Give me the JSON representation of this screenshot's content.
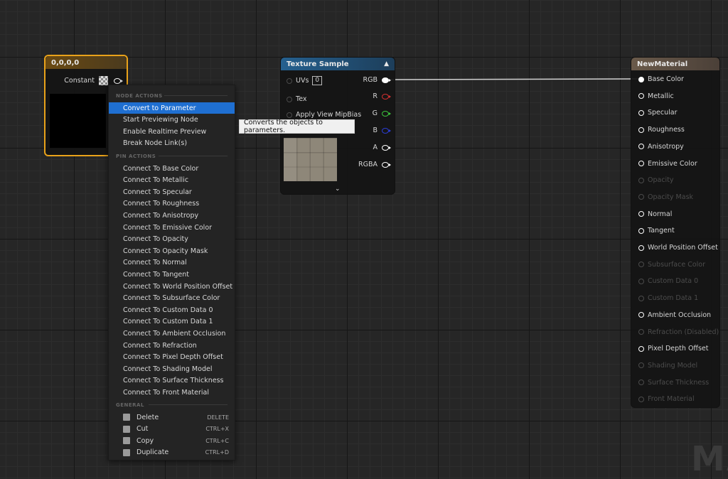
{
  "constant_node": {
    "title": "0,0,0,0",
    "pin_label": "Constant"
  },
  "texture_node": {
    "title": "Texture Sample",
    "inputs": [
      {
        "label": "UVs",
        "value": "0"
      },
      {
        "label": "Tex"
      },
      {
        "label": "Apply View MipBias"
      }
    ],
    "outputs": [
      "RGB",
      "R",
      "G",
      "B",
      "A",
      "RGBA"
    ]
  },
  "material_node": {
    "title": "NewMaterial",
    "pins": [
      {
        "label": "Base Color",
        "enabled": true
      },
      {
        "label": "Metallic",
        "enabled": true
      },
      {
        "label": "Specular",
        "enabled": true
      },
      {
        "label": "Roughness",
        "enabled": true
      },
      {
        "label": "Anisotropy",
        "enabled": true
      },
      {
        "label": "Emissive Color",
        "enabled": true
      },
      {
        "label": "Opacity",
        "enabled": false
      },
      {
        "label": "Opacity Mask",
        "enabled": false
      },
      {
        "label": "Normal",
        "enabled": true
      },
      {
        "label": "Tangent",
        "enabled": true
      },
      {
        "label": "World Position Offset",
        "enabled": true
      },
      {
        "label": "Subsurface Color",
        "enabled": false
      },
      {
        "label": "Custom Data 0",
        "enabled": false
      },
      {
        "label": "Custom Data 1",
        "enabled": false
      },
      {
        "label": "Ambient Occlusion",
        "enabled": true
      },
      {
        "label": "Refraction (Disabled)",
        "enabled": false
      },
      {
        "label": "Pixel Depth Offset",
        "enabled": true
      },
      {
        "label": "Shading Model",
        "enabled": false
      },
      {
        "label": "Surface Thickness",
        "enabled": false
      },
      {
        "label": "Front Material",
        "enabled": false
      }
    ]
  },
  "context_menu": {
    "node_actions_header": "NODE ACTIONS",
    "node_actions": [
      "Convert to Parameter",
      "Start Previewing Node",
      "Enable Realtime Preview",
      "Break Node Link(s)"
    ],
    "pin_actions_header": "PIN ACTIONS",
    "pin_actions": [
      "Connect To Base Color",
      "Connect To Metallic",
      "Connect To Specular",
      "Connect To Roughness",
      "Connect To Anisotropy",
      "Connect To Emissive Color",
      "Connect To Opacity",
      "Connect To Opacity Mask",
      "Connect To Normal",
      "Connect To Tangent",
      "Connect To World Position Offset",
      "Connect To Subsurface Color",
      "Connect To Custom Data 0",
      "Connect To Custom Data 1",
      "Connect To Ambient Occlusion",
      "Connect To Refraction",
      "Connect To Pixel Depth Offset",
      "Connect To Shading Model",
      "Connect To Surface Thickness",
      "Connect To Front Material"
    ],
    "general_header": "GENERAL",
    "general": [
      {
        "label": "Delete",
        "shortcut": "DELETE",
        "icon": "trash-icon"
      },
      {
        "label": "Cut",
        "shortcut": "CTRL+X",
        "icon": "cut-icon"
      },
      {
        "label": "Copy",
        "shortcut": "CTRL+C",
        "icon": "copy-icon"
      },
      {
        "label": "Duplicate",
        "shortcut": "CTRL+D",
        "icon": "duplicate-icon"
      }
    ]
  },
  "tooltip": "Converts the objects to parameters.",
  "watermark": "MA",
  "colors": {
    "selection_orange": "#e9a21a",
    "menu_highlight": "#1f6fd1",
    "pin_r": "#d23030",
    "pin_g": "#3cc43c",
    "pin_b": "#2a3dd6"
  }
}
